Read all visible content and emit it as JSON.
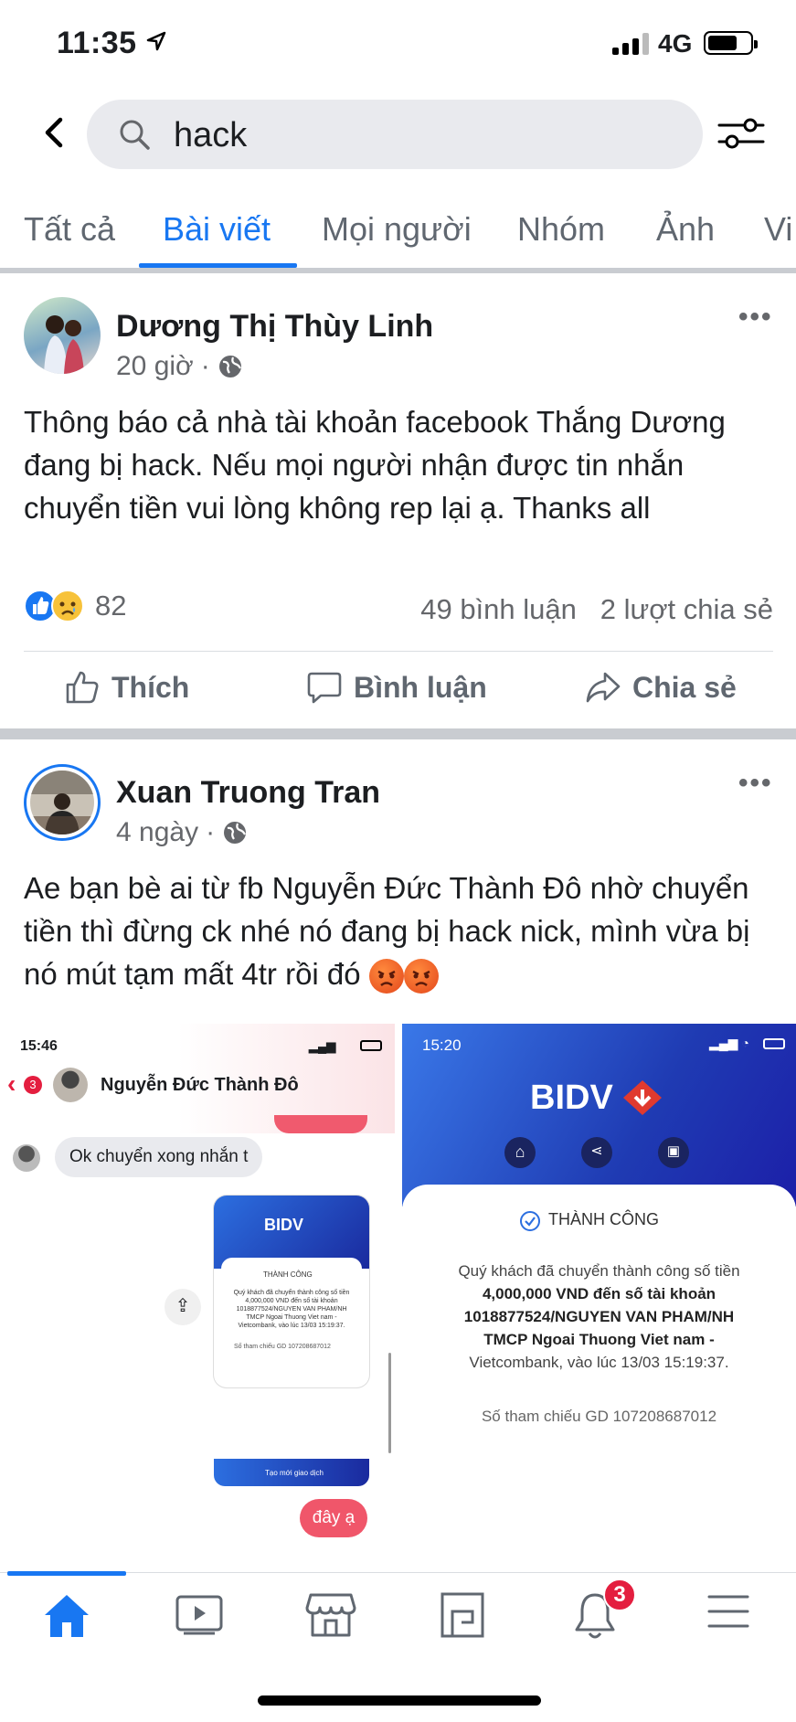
{
  "status_bar": {
    "time": "11:35",
    "network": "4G"
  },
  "search": {
    "query": "hack"
  },
  "tabs": [
    {
      "label": "Tất cả",
      "active": false
    },
    {
      "label": "Bài viết",
      "active": true
    },
    {
      "label": "Mọi người",
      "active": false
    },
    {
      "label": "Nhóm",
      "active": false
    },
    {
      "label": "Ảnh",
      "active": false
    },
    {
      "label": "Vi",
      "active": false
    }
  ],
  "post1": {
    "author": "Dương Thị Thùy Linh",
    "time": "20 giờ",
    "text": "Thông báo cả nhà tài khoản facebook Thắng Dương đang bị hack. Nếu mọi người nhận được tin nhắn chuyển tiền vui lòng không rep lại ạ. Thanks all",
    "reaction_count": "82",
    "comments": "49 bình luận",
    "shares": "2 lượt chia sẻ",
    "like_label": "Thích",
    "comment_label": "Bình luận",
    "share_label": "Chia sẻ"
  },
  "post2": {
    "author": "Xuan Truong Tran",
    "time": "4 ngày",
    "text": "Ae bạn bè ai từ fb Nguyễn Đức Thành Đô nhờ chuyển tiền thì đừng ck nhé nó đang bị hack nick, mình vừa bị nó mút tạm mất 4tr rồi đó",
    "image_left": {
      "time": "15:46",
      "badge": "3",
      "contact": "Nguyễn Đức Thành Đô",
      "message": "Ok chuyển xong nhắn t",
      "mini_bank": "BIDV",
      "mini_status": "THÀNH CÔNG",
      "mini_text": "Quý khách đã chuyển thành công số tiền 4,000,000 VND đến số tài khoản 1018877524/NGUYEN VAN PHAM/NH TMCP Ngoai Thuong Viet nam - Vietcombank, vào lúc 13/03 15:19:37.",
      "mini_ref": "Số tham chiếu GD 107208687012",
      "mini_button": "Tạo mới giao dịch",
      "reply": "đây ạ"
    },
    "image_right": {
      "time": "15:20",
      "bank": "BIDV",
      "status": "THÀNH CÔNG",
      "line1": "Quý khách đã chuyển thành công số tiền",
      "line2": "4,000,000 VND đến số tài khoản",
      "line3": "1018877524/NGUYEN VAN PHAM/NH",
      "line4": "TMCP Ngoai Thuong Viet nam -",
      "line5": "Vietcombank, vào lúc 13/03 15:19:37.",
      "ref": "Số tham chiếu GD 107208687012"
    }
  },
  "bottom_nav": {
    "notification_badge": "3"
  },
  "colors": {
    "accent": "#1877f2",
    "bidv_blue": "#1f3bb3",
    "badge_red": "#e41e3f"
  }
}
